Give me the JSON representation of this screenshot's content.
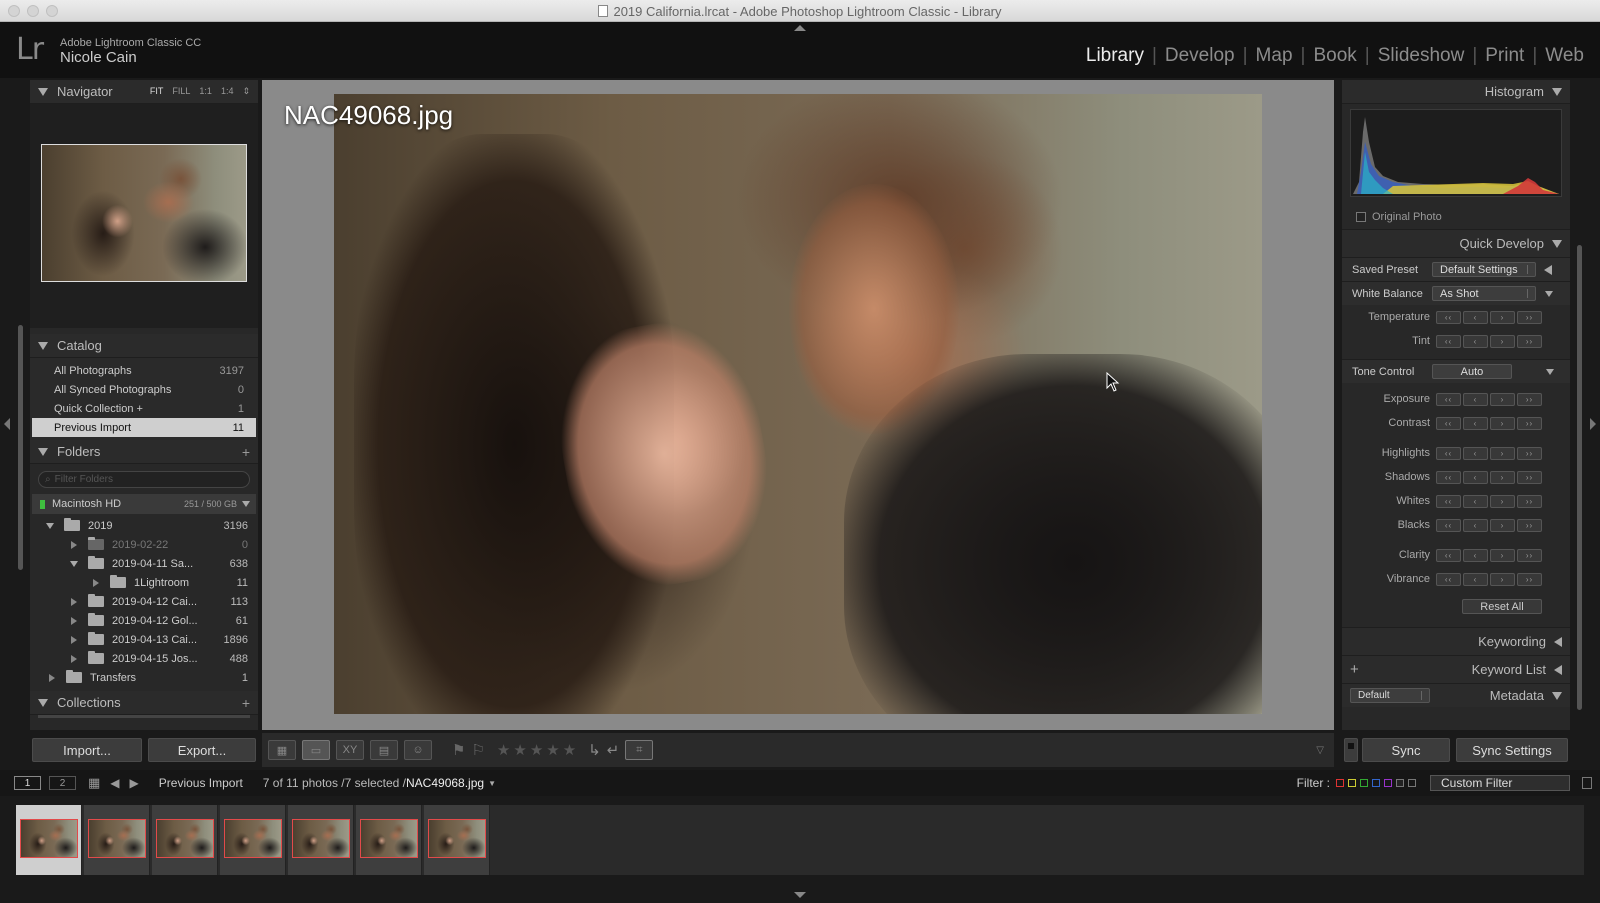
{
  "window": {
    "title": "2019 California.lrcat - Adobe Photoshop Lightroom Classic - Library"
  },
  "identity": {
    "app_name": "Adobe Lightroom Classic CC",
    "user_name": "Nicole Cain",
    "logo": "Lr"
  },
  "modules": [
    "Library",
    "Develop",
    "Map",
    "Book",
    "Slideshow",
    "Print",
    "Web"
  ],
  "active_module": "Library",
  "navigator": {
    "title": "Navigator",
    "options": [
      "FIT",
      "FILL",
      "1:1",
      "1:4"
    ],
    "active_option": "FIT"
  },
  "catalog": {
    "title": "Catalog",
    "items": [
      {
        "label": "All Photographs",
        "count": "3197"
      },
      {
        "label": "All Synced Photographs",
        "count": "0"
      },
      {
        "label": "Quick Collection +",
        "count": "1"
      },
      {
        "label": "Previous Import",
        "count": "11"
      }
    ],
    "selected": "Previous Import"
  },
  "folders": {
    "title": "Folders",
    "filter_placeholder": "Filter Folders",
    "volume": {
      "name": "Macintosh HD",
      "space": "251 / 500 GB"
    },
    "items": [
      {
        "name": "2019",
        "count": "3196"
      },
      {
        "name": "2019-02-22",
        "count": "0"
      },
      {
        "name": "2019-04-11 Sa...",
        "count": "638"
      },
      {
        "name": "1Lightroom",
        "count": "11"
      },
      {
        "name": "2019-04-12 Cai...",
        "count": "113"
      },
      {
        "name": "2019-04-12 Gol...",
        "count": "61"
      },
      {
        "name": "2019-04-13 Cai...",
        "count": "1896"
      },
      {
        "name": "2019-04-15 Jos...",
        "count": "488"
      },
      {
        "name": "Transfers",
        "count": "1"
      }
    ]
  },
  "collections": {
    "title": "Collections"
  },
  "left_buttons": {
    "import": "Import...",
    "export": "Export..."
  },
  "main": {
    "filename": "NAC49068.jpg"
  },
  "right": {
    "histogram": "Histogram",
    "original_photo": "Original Photo",
    "quick_develop": "Quick Develop",
    "saved_preset": {
      "label": "Saved Preset",
      "value": "Default Settings"
    },
    "white_balance": {
      "label": "White Balance",
      "value": "As Shot"
    },
    "wb_controls": [
      "Temperature",
      "Tint"
    ],
    "tone_control": {
      "label": "Tone Control",
      "button": "Auto"
    },
    "tone_controls_1": [
      "Exposure",
      "Contrast"
    ],
    "tone_controls_2": [
      "Highlights",
      "Shadows",
      "Whites",
      "Blacks"
    ],
    "tone_controls_3": [
      "Clarity",
      "Vibrance"
    ],
    "reset_all": "Reset All",
    "keywording": "Keywording",
    "keyword_list": "Keyword List",
    "metadata": "Metadata",
    "metadata_preset": "Default",
    "sync": "Sync",
    "sync_settings": "Sync Settings"
  },
  "filmstrip_bar": {
    "screen_1": "1",
    "screen_2": "2",
    "source": "Previous Import",
    "status": "7 of 11 photos /7 selected /",
    "current_file": "NAC49068.jpg",
    "filter_label": "Filter :",
    "filter_value": "Custom Filter"
  },
  "filmstrip": {
    "thumbnails": 7
  },
  "colors": {
    "accent_selected": "#cfcfcf",
    "thumb_border": "#e24a4a",
    "volume_led": "#3fbf3f"
  }
}
